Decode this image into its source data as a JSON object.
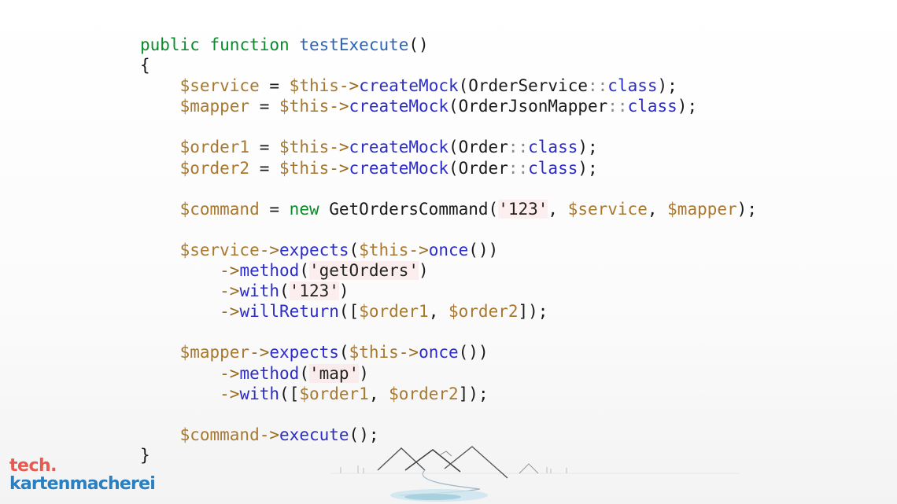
{
  "code": {
    "lines": [
      [
        {
          "t": "public",
          "c": "kw"
        },
        {
          "t": " ",
          "c": "pl"
        },
        {
          "t": "function",
          "c": "kw"
        },
        {
          "t": " ",
          "c": "pl"
        },
        {
          "t": "testExecute",
          "c": "fn"
        },
        {
          "t": "()",
          "c": "pl"
        }
      ],
      [
        {
          "t": "{",
          "c": "pl"
        }
      ],
      [
        {
          "t": "    ",
          "c": "pl"
        },
        {
          "t": "$service",
          "c": "var"
        },
        {
          "t": " = ",
          "c": "pl"
        },
        {
          "t": "$this",
          "c": "var"
        },
        {
          "t": "->",
          "c": "op"
        },
        {
          "t": "createMock",
          "c": "mth"
        },
        {
          "t": "(OrderService",
          "c": "pl"
        },
        {
          "t": "::",
          "c": "sep"
        },
        {
          "t": "class",
          "c": "mth"
        },
        {
          "t": ");",
          "c": "pl"
        }
      ],
      [
        {
          "t": "    ",
          "c": "pl"
        },
        {
          "t": "$mapper",
          "c": "var"
        },
        {
          "t": " = ",
          "c": "pl"
        },
        {
          "t": "$this",
          "c": "var"
        },
        {
          "t": "->",
          "c": "op"
        },
        {
          "t": "createMock",
          "c": "mth"
        },
        {
          "t": "(OrderJsonMapper",
          "c": "pl"
        },
        {
          "t": "::",
          "c": "sep"
        },
        {
          "t": "class",
          "c": "mth"
        },
        {
          "t": ");",
          "c": "pl"
        }
      ],
      [],
      [
        {
          "t": "    ",
          "c": "pl"
        },
        {
          "t": "$order1",
          "c": "var"
        },
        {
          "t": " = ",
          "c": "pl"
        },
        {
          "t": "$this",
          "c": "var"
        },
        {
          "t": "->",
          "c": "op"
        },
        {
          "t": "createMock",
          "c": "mth"
        },
        {
          "t": "(Order",
          "c": "pl"
        },
        {
          "t": "::",
          "c": "sep"
        },
        {
          "t": "class",
          "c": "mth"
        },
        {
          "t": ");",
          "c": "pl"
        }
      ],
      [
        {
          "t": "    ",
          "c": "pl"
        },
        {
          "t": "$order2",
          "c": "var"
        },
        {
          "t": " = ",
          "c": "pl"
        },
        {
          "t": "$this",
          "c": "var"
        },
        {
          "t": "->",
          "c": "op"
        },
        {
          "t": "createMock",
          "c": "mth"
        },
        {
          "t": "(Order",
          "c": "pl"
        },
        {
          "t": "::",
          "c": "sep"
        },
        {
          "t": "class",
          "c": "mth"
        },
        {
          "t": ");",
          "c": "pl"
        }
      ],
      [],
      [
        {
          "t": "    ",
          "c": "pl"
        },
        {
          "t": "$command",
          "c": "var"
        },
        {
          "t": " = ",
          "c": "pl"
        },
        {
          "t": "new",
          "c": "kw"
        },
        {
          "t": " GetOrdersCommand(",
          "c": "pl"
        },
        {
          "t": "'123'",
          "c": "str"
        },
        {
          "t": ", ",
          "c": "pl"
        },
        {
          "t": "$service",
          "c": "var"
        },
        {
          "t": ", ",
          "c": "pl"
        },
        {
          "t": "$mapper",
          "c": "var"
        },
        {
          "t": ");",
          "c": "pl"
        }
      ],
      [],
      [
        {
          "t": "    ",
          "c": "pl"
        },
        {
          "t": "$service",
          "c": "var"
        },
        {
          "t": "->",
          "c": "op"
        },
        {
          "t": "expects",
          "c": "mth"
        },
        {
          "t": "(",
          "c": "pl"
        },
        {
          "t": "$this",
          "c": "var"
        },
        {
          "t": "->",
          "c": "op"
        },
        {
          "t": "once",
          "c": "mth"
        },
        {
          "t": "())",
          "c": "pl"
        }
      ],
      [
        {
          "t": "        ",
          "c": "pl"
        },
        {
          "t": "->",
          "c": "op"
        },
        {
          "t": "method",
          "c": "mth"
        },
        {
          "t": "(",
          "c": "pl"
        },
        {
          "t": "'getOrders'",
          "c": "str"
        },
        {
          "t": ")",
          "c": "pl"
        }
      ],
      [
        {
          "t": "        ",
          "c": "pl"
        },
        {
          "t": "->",
          "c": "op"
        },
        {
          "t": "with",
          "c": "mth"
        },
        {
          "t": "(",
          "c": "pl"
        },
        {
          "t": "'123'",
          "c": "str"
        },
        {
          "t": ")",
          "c": "pl"
        }
      ],
      [
        {
          "t": "        ",
          "c": "pl"
        },
        {
          "t": "->",
          "c": "op"
        },
        {
          "t": "willReturn",
          "c": "mth"
        },
        {
          "t": "([",
          "c": "pl"
        },
        {
          "t": "$order1",
          "c": "var"
        },
        {
          "t": ", ",
          "c": "pl"
        },
        {
          "t": "$order2",
          "c": "var"
        },
        {
          "t": "]);",
          "c": "pl"
        }
      ],
      [],
      [
        {
          "t": "    ",
          "c": "pl"
        },
        {
          "t": "$mapper",
          "c": "var"
        },
        {
          "t": "->",
          "c": "op"
        },
        {
          "t": "expects",
          "c": "mth"
        },
        {
          "t": "(",
          "c": "pl"
        },
        {
          "t": "$this",
          "c": "var"
        },
        {
          "t": "->",
          "c": "op"
        },
        {
          "t": "once",
          "c": "mth"
        },
        {
          "t": "())",
          "c": "pl"
        }
      ],
      [
        {
          "t": "        ",
          "c": "pl"
        },
        {
          "t": "->",
          "c": "op"
        },
        {
          "t": "method",
          "c": "mth"
        },
        {
          "t": "(",
          "c": "pl"
        },
        {
          "t": "'map'",
          "c": "str"
        },
        {
          "t": ")",
          "c": "pl"
        }
      ],
      [
        {
          "t": "        ",
          "c": "pl"
        },
        {
          "t": "->",
          "c": "op"
        },
        {
          "t": "with",
          "c": "mth"
        },
        {
          "t": "([",
          "c": "pl"
        },
        {
          "t": "$order1",
          "c": "var"
        },
        {
          "t": ", ",
          "c": "pl"
        },
        {
          "t": "$order2",
          "c": "var"
        },
        {
          "t": "]);",
          "c": "pl"
        }
      ],
      [],
      [
        {
          "t": "    ",
          "c": "pl"
        },
        {
          "t": "$command",
          "c": "var"
        },
        {
          "t": "->",
          "c": "op"
        },
        {
          "t": "execute",
          "c": "mth"
        },
        {
          "t": "();",
          "c": "pl"
        }
      ],
      [
        {
          "t": "}",
          "c": "pl"
        }
      ]
    ]
  },
  "brand": {
    "line1": "tech.",
    "line2": "kartenmacherei",
    "color_primary": "#e8594f",
    "color_secondary": "#2a7fc0"
  },
  "decoration": {
    "icon": "mountains-lake-icon"
  }
}
